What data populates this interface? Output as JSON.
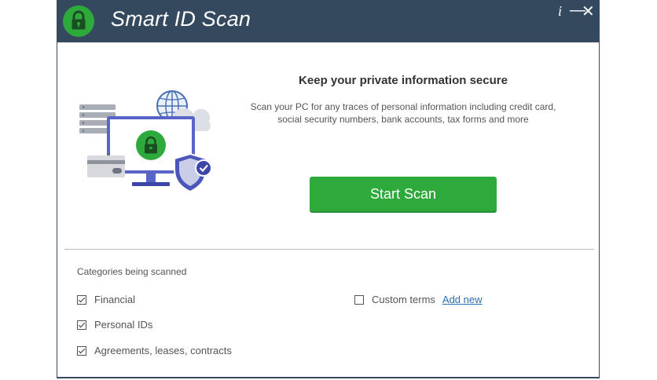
{
  "window": {
    "title": "Smart ID Scan",
    "info_glyph": "i",
    "minimize_glyph": "—",
    "close_glyph": "✕"
  },
  "colors": {
    "titlebar": "#34495e",
    "accent_green": "#2eaa3d",
    "link_blue": "#2a6fb6"
  },
  "main": {
    "headline": "Keep your private information secure",
    "description_line1": "Scan your PC for any traces of personal information including credit card,",
    "description_line2": "social security numbers, bank accounts, tax forms and more",
    "start_button_label": "Start Scan"
  },
  "categories": {
    "heading": "Categories being scanned",
    "items": [
      {
        "label": "Financial",
        "checked": true
      },
      {
        "label": "Personal IDs",
        "checked": true
      },
      {
        "label": "Agreements, leases, contracts",
        "checked": true
      }
    ],
    "custom": {
      "label": "Custom terms",
      "checked": false,
      "link": "Add new"
    }
  },
  "icons": {
    "logo": "lock-icon",
    "illustration": "secure-pc-illustration"
  }
}
